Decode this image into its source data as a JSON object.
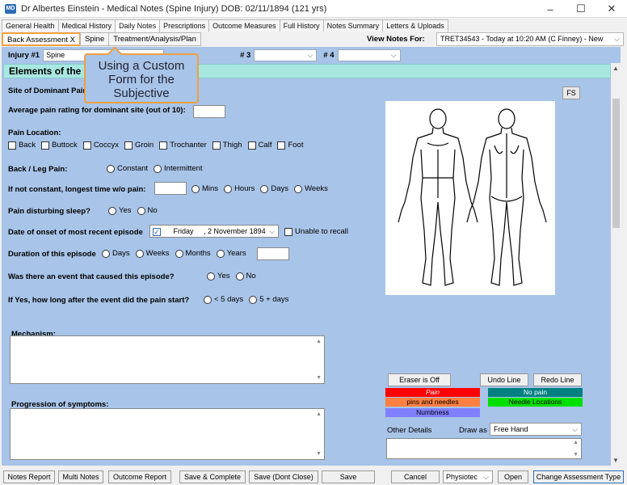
{
  "window": {
    "title": "Dr Albertes Einstein - Medical Notes (Spine Injury) DOB: 02/11/1894 (121 yrs)",
    "app_icon": "MD",
    "minimize": "–",
    "maximize": "☐",
    "close": "✕"
  },
  "main_tabs": [
    "General Health",
    "Medical History",
    "Daily Notes",
    "Prescriptions",
    "Outcome Measures",
    "Full History",
    "Notes Summary",
    "Letters & Uploads"
  ],
  "sub_tabs": [
    "Back Assessment X",
    "Spine",
    "Treatment/Analysis/Plan"
  ],
  "view_notes": {
    "label": "View Notes For:",
    "value": "TRET34543 - Today at 10:20 AM (C Finney) - New"
  },
  "injury": {
    "l1": "Injury #1",
    "v1": "Spine",
    "l3": "# 3",
    "l4": "# 4"
  },
  "section_title": "Elements of the Subjective",
  "callout": "Using a Custom Form for the Subjective",
  "fields": {
    "site": "Site of Dominant Pain",
    "avg_pain": "Average pain rating for dominant site (out of 10):",
    "pain_location": "Pain Location:",
    "locations": [
      "Back",
      "Buttock",
      "Coccyx",
      "Groin",
      "Trochanter",
      "Thigh",
      "Calf",
      "Foot"
    ],
    "back_leg": "Back / Leg Pain:",
    "back_leg_opts": [
      "Constant",
      "Intermittent"
    ],
    "longest": "If not constant, longest time w/o pain:",
    "longest_opts": [
      "Mins",
      "Hours",
      "Days",
      "Weeks"
    ],
    "sleep": "Pain disturbing sleep?",
    "yes": "Yes",
    "no": "No",
    "onset": "Date of onset of most recent episode",
    "onset_day": "Friday",
    "onset_date": ", 2 November 1894",
    "unable": "Unable to recall",
    "duration": "Duration of this episode",
    "duration_opts": [
      "Days",
      "Weeks",
      "Months",
      "Years"
    ],
    "event": "Was there an event that caused this episode?",
    "after": "If Yes, how long after the event did the pain start?",
    "after_opts": [
      "< 5 days",
      "5 + days"
    ],
    "mechanism": "Mechanism:",
    "progression": "Progression of symptoms:"
  },
  "panel": {
    "fs": "FS",
    "eraser": "Eraser is Off",
    "undo": "Undo Line",
    "redo": "Redo Line",
    "pain": "Pain",
    "no_pain": "No pain",
    "pins": "pins and needles",
    "needle": "Needle Locations",
    "numb": "Numbness",
    "other": "Other Details",
    "draw_as": "Draw as",
    "draw_val": "Free Hand"
  },
  "bottom": {
    "notes_report": "Notes Report",
    "multi": "Multi Notes",
    "outcome": "Outcome Report",
    "save_complete": "Save & Complete",
    "save_dont": "Save (Dont Close)",
    "save": "Save",
    "cancel": "Cancel",
    "physio": "Physiotec",
    "open": "Open",
    "change": "Change Assessment Type"
  },
  "colors": {
    "pain": "#ff0000",
    "no_pain": "#008080",
    "pins": "#ff8040",
    "needle": "#00e000",
    "numb": "#8080ff",
    "accent": "#f0a040"
  }
}
